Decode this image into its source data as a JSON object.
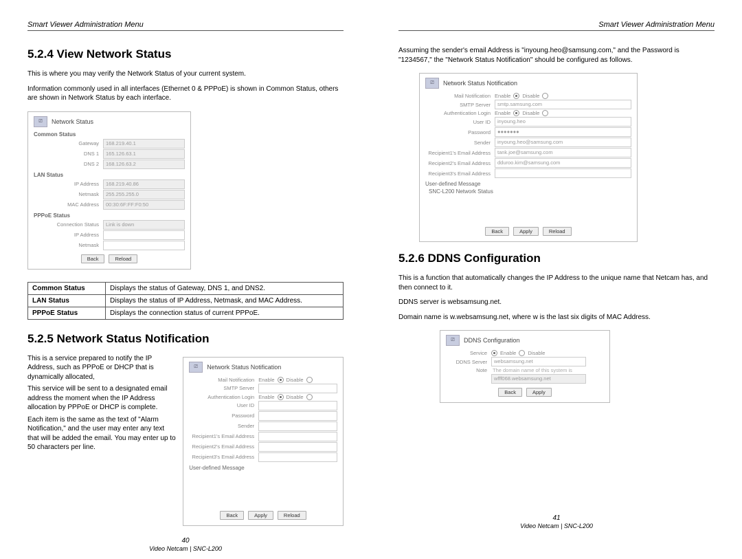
{
  "header": "Smart Viewer Administration Menu",
  "footer_product": "Video Netcam | SNC-L200",
  "left": {
    "page_no": "40",
    "s524": {
      "heading": "5.2.4 View Network Status",
      "para1": "This is where you may verify the Network Status of your current system.",
      "para2": "Information commonly used in all interfaces (Ethernet 0 & PPPoE) is shown in Common Status, others are shown in Network Status by each interface.",
      "panel": {
        "title": "Network Status",
        "common_label": "Common Status",
        "lan_label": "LAN Status",
        "pppoe_label": "PPPoE Status",
        "fields": {
          "gateway_l": "Gateway",
          "gateway_v": "168.219.40.1",
          "dns1_l": "DNS 1",
          "dns1_v": "165.126.63.1",
          "dns2_l": "DNS 2",
          "dns2_v": "168.126.63.2",
          "ip_l": "IP Address",
          "ip_v": "168.219.40.86",
          "netmask_l": "Netmask",
          "netmask_v": "255.255.255.0",
          "mac_l": "MAC Address",
          "mac_v": "00:30:6F:FF:F0:50",
          "conn_l": "Connection Status",
          "conn_v": "Link is down",
          "pip_l": "IP Address",
          "pip_v": "",
          "pnm_l": "Netmask",
          "pnm_v": ""
        },
        "btn_back": "Back",
        "btn_reload": "Reload"
      },
      "table": {
        "r1k": "Common Status",
        "r1v": "Displays the status of Gateway, DNS 1, and DNS2.",
        "r2k": "LAN Status",
        "r2v": "Displays the status of IP Address, Netmask, and MAC Address.",
        "r3k": "PPPoE Status",
        "r3v": "Displays the connection status of current PPPoE."
      }
    },
    "s525": {
      "heading": "5.2.5 Network Status Notification",
      "p1": "This is a service prepared to notify the IP Address, such as PPPoE or DHCP that is dynamically allocated,",
      "p2": "This service will be sent to a designated email address the moment when the IP Address allocation by PPPoE or DHCP is complete.",
      "p3": "Each item is the same as the text of \"Alarm Notification,\" and the user may enter any text that will be added the email. You may enter up to 50 characters per line.",
      "panel": {
        "title": "Network Status Notification",
        "mail_l": "Mail Notification",
        "enable": "Enable",
        "disable": "Disable",
        "smtp_l": "SMTP Server",
        "smtp_v": "",
        "auth_l": "Authentication Login",
        "uid_l": "User ID",
        "uid_v": "",
        "pw_l": "Password",
        "pw_v": "",
        "sender_l": "Sender",
        "sender_v": "",
        "r1_l": "Recipient1's Email Address",
        "r1_v": "",
        "r2_l": "Recipient2's Email Address",
        "r2_v": "",
        "r3_l": "Recipient3's Email Address",
        "r3_v": "",
        "udm_l": "User-defined Message",
        "btn_back": "Back",
        "btn_apply": "Apply",
        "btn_reload": "Reload"
      }
    }
  },
  "right": {
    "page_no": "41",
    "intro": "Assuming the sender's email Address is \"inyoung.heo@samsung.com,\" and the Password is \"1234567,\" the \"Network Status Notification\" should be configured as follows.",
    "panel1": {
      "title": "Network Status Notification",
      "mail_l": "Mail Notification",
      "enable": "Enable",
      "disable": "Disable",
      "smtp_l": "SMTP Server",
      "smtp_v": "smtp.samsung.com",
      "auth_l": "Authentication Login",
      "uid_l": "User ID",
      "uid_v": "inyoung.heo",
      "pw_l": "Password",
      "pw_v": "●●●●●●●",
      "sender_l": "Sender",
      "sender_v": "inyoung.heo@samsung.com",
      "r1_l": "Recipient1's Email Address",
      "r1_v": "tank.joe@samsung.com",
      "r2_l": "Recipient2's Email Address",
      "r2_v": "dduroo.kim@samsung.com",
      "r3_l": "Recipient3's Email Address",
      "r3_v": "",
      "udm_l": "User-defined Message",
      "msg1": "SNC-L200 Network Status",
      "btn_back": "Back",
      "btn_apply": "Apply",
      "btn_reload": "Reload"
    },
    "s526": {
      "heading": "5.2.6 DDNS Configuration",
      "p1": "This is a function that automatically changes the IP Address to the unique name that Netcam has, and then connect to it.",
      "p2": "DDNS server is websamsung.net.",
      "p3": "Domain name is w.websamsung.net, where w is the last six digits of MAC Address.",
      "panel": {
        "title": "DDNS Configuration",
        "service_l": "Service",
        "enable": "Enable",
        "disable": "Disable",
        "server_l": "DDNS Server",
        "server_v": "websamsung.net",
        "note_l": "Note",
        "note_v": "The domain name of this system is",
        "domain_v": "wfff068.websamsung.net",
        "btn_back": "Back",
        "btn_apply": "Apply"
      }
    }
  }
}
